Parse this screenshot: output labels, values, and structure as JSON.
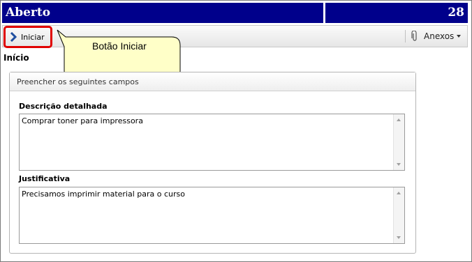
{
  "header": {
    "title": "Aberto",
    "count": "28"
  },
  "toolbar": {
    "start_label": "Iniciar",
    "attachments_label": "Anexos",
    "start_icon": "chevron-right-icon",
    "attachments_icon": "paperclip-icon"
  },
  "callout": {
    "text": "Botão Iniciar"
  },
  "section": {
    "title": "Início"
  },
  "panel": {
    "header": "Preencher os seguintes campos",
    "fields": [
      {
        "label": "Descrição detalhada",
        "value": "Comprar toner para impressora"
      },
      {
        "label": "Justificativa",
        "value": "Precisamos imprimir material para o curso"
      }
    ]
  },
  "colors": {
    "titlebar": "#00008b",
    "highlight": "#e00000",
    "callout_bg": "#ffffc8",
    "chevron": "#1f4fa0"
  }
}
